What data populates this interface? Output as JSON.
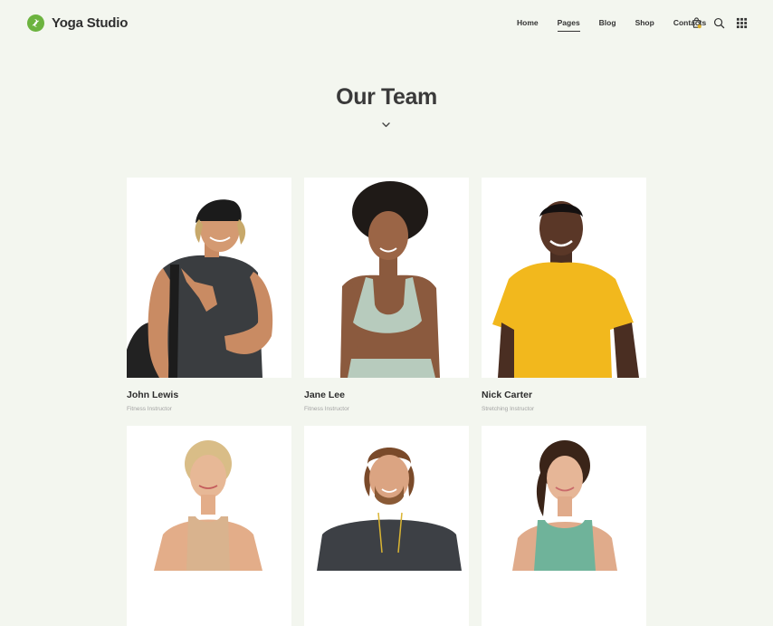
{
  "header": {
    "brand": "Yoga Studio",
    "nav": [
      "Home",
      "Pages",
      "Blog",
      "Shop",
      "Contacts"
    ],
    "active_nav": "Pages",
    "icons": [
      "cart-icon",
      "search-icon",
      "grid-menu-icon"
    ]
  },
  "main": {
    "title": "Our Team",
    "members": [
      {
        "name": "John Lewis",
        "role": "Fitness Instructor"
      },
      {
        "name": "Jane Lee",
        "role": "Fitness Instructor"
      },
      {
        "name": "Nick Carter",
        "role": "Stretching Instructor"
      },
      {
        "name": "",
        "role": ""
      },
      {
        "name": "",
        "role": ""
      },
      {
        "name": "",
        "role": ""
      }
    ]
  },
  "colors": {
    "background": "#f3f6ef",
    "accent_green": "#6cb33f",
    "card_bg": "#ffffff",
    "text_dark": "#2d2d2d",
    "text_muted": "#a3a3a3"
  }
}
